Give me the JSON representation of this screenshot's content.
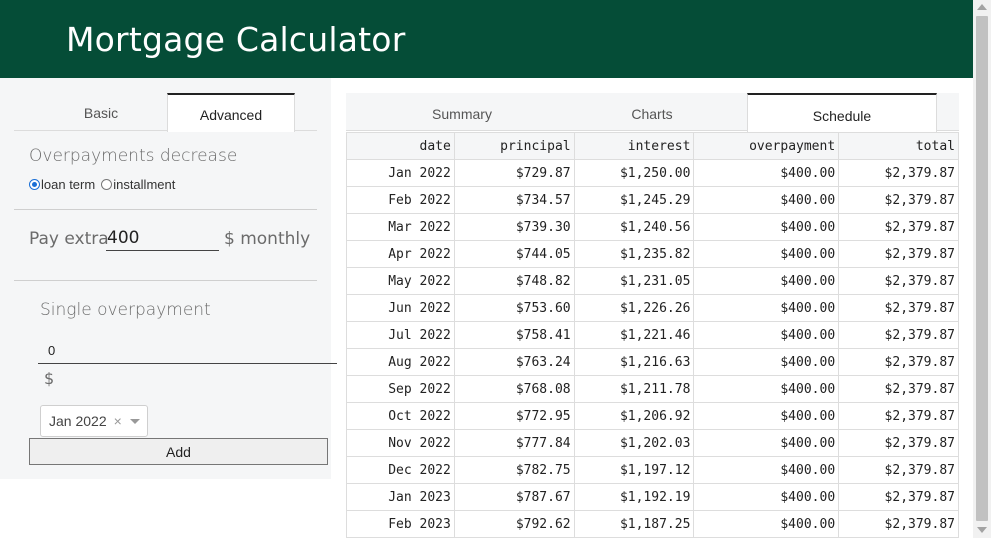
{
  "header": {
    "title": "Mortgage Calculator"
  },
  "left_tabs": [
    {
      "label": "Basic"
    },
    {
      "label": "Advanced"
    }
  ],
  "overpayments": {
    "title": "Overpayments decrease",
    "options": [
      {
        "label": "loan term",
        "selected": true
      },
      {
        "label": "installment",
        "selected": false
      }
    ]
  },
  "pay_extra": {
    "label": "Pay extra",
    "value": "400",
    "unit": "$ monthly"
  },
  "single_overpayment": {
    "title": "Single overpayment",
    "value": "0",
    "currency": "$",
    "date_selected": "Jan 2022",
    "clear_symbol": "×",
    "add_label": "Add"
  },
  "right_tabs": [
    {
      "label": "Summary"
    },
    {
      "label": "Charts"
    },
    {
      "label": "Schedule"
    }
  ],
  "schedule": {
    "columns": [
      "date",
      "principal",
      "interest",
      "overpayment",
      "total"
    ],
    "rows": [
      [
        "Jan 2022",
        "$729.87",
        "$1,250.00",
        "$400.00",
        "$2,379.87"
      ],
      [
        "Feb 2022",
        "$734.57",
        "$1,245.29",
        "$400.00",
        "$2,379.87"
      ],
      [
        "Mar 2022",
        "$739.30",
        "$1,240.56",
        "$400.00",
        "$2,379.87"
      ],
      [
        "Apr 2022",
        "$744.05",
        "$1,235.82",
        "$400.00",
        "$2,379.87"
      ],
      [
        "May 2022",
        "$748.82",
        "$1,231.05",
        "$400.00",
        "$2,379.87"
      ],
      [
        "Jun 2022",
        "$753.60",
        "$1,226.26",
        "$400.00",
        "$2,379.87"
      ],
      [
        "Jul 2022",
        "$758.41",
        "$1,221.46",
        "$400.00",
        "$2,379.87"
      ],
      [
        "Aug 2022",
        "$763.24",
        "$1,216.63",
        "$400.00",
        "$2,379.87"
      ],
      [
        "Sep 2022",
        "$768.08",
        "$1,211.78",
        "$400.00",
        "$2,379.87"
      ],
      [
        "Oct 2022",
        "$772.95",
        "$1,206.92",
        "$400.00",
        "$2,379.87"
      ],
      [
        "Nov 2022",
        "$777.84",
        "$1,202.03",
        "$400.00",
        "$2,379.87"
      ],
      [
        "Dec 2022",
        "$782.75",
        "$1,197.12",
        "$400.00",
        "$2,379.87"
      ],
      [
        "Jan 2023",
        "$787.67",
        "$1,192.19",
        "$400.00",
        "$2,379.87"
      ],
      [
        "Feb 2023",
        "$792.62",
        "$1,187.25",
        "$400.00",
        "$2,379.87"
      ]
    ]
  },
  "colors": {
    "header_bg": "#054d37",
    "header_text": "#ffffff",
    "panel_bg": "#f5f6f7",
    "radio_accent": "#1a6fd6"
  }
}
